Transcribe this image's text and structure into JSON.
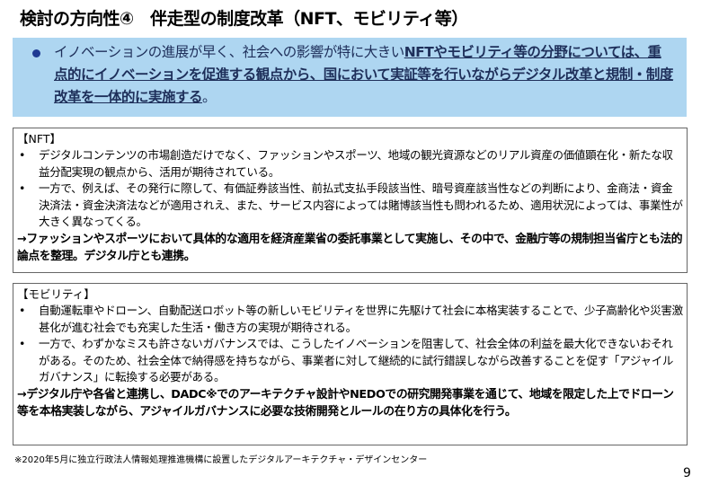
{
  "title": "検討の方向性④　伴走型の制度改革（NFT、モビリティ等）",
  "summary": {
    "lead": "イノベーションの進展が早く、社会への影響が特に大きい",
    "strong": "NFTやモビリティ等の分野については、重点的にイノベーションを促進する観点から、国において実証等を行いながらデジタル改革と規制・制度改革を一体的に実施する",
    "tail": "。"
  },
  "nft": {
    "heading": "【NFT】",
    "items": [
      "デジタルコンテンツの市場創造だけでなく、ファッションやスポーツ、地域の観光資源などのリアル資産の価値顕在化・新たな収益分配実現の観点から、活用が期待されている。",
      "一方で、例えば、その発行に際して、有価証券該当性、前払式支払手段該当性、暗号資産該当性などの判断により、金商法・資金決済法・資金決済法などが適用されえ、また、サービス内容によっては賭博該当性も問われるため、適用状況によっては、事業性が大きく異なってくる。"
    ],
    "conclusion": "→ファッションやスポーツにおいて具体的な適用を経済産業省の委託事業として実施し、その中で、金融庁等の規制担当省庁とも法的論点を整理。デジタル庁とも連携。"
  },
  "mobility": {
    "heading": "【モビリティ】",
    "items": [
      "自動運転車やドローン、自動配送ロボット等の新しいモビリティを世界に先駆けて社会に本格実装することで、少子高齢化や災害激甚化が進む社会でも充実した生活・働き方の実現が期待される。",
      "一方で、わずかなミスも許さないガバナンスでは、こうしたイノベーションを阻害して、社会全体の利益を最大化できないおそれがある。そのため、社会全体で納得感を持ちながら、事業者に対して継続的に試行錯誤しながら改善することを促す「アジャイルガバナンス」に転換する必要がある。"
    ],
    "conclusion": "→デジタル庁や各省と連携し、DADC※でのアーキテクチャ設計やNEDOでの研究開発事業を通じて、地域を限定した上でドローン等を本格実装しながら、アジャイルガバナンスに必要な技術開発とルールの在り方の具体化を行う。"
  },
  "footnote": "※2020年5月に独立行政法人情報処理推進機構に設置したデジタルアーキテクチャ・デザインセンター",
  "page_number": "9",
  "bullet_char": "•"
}
